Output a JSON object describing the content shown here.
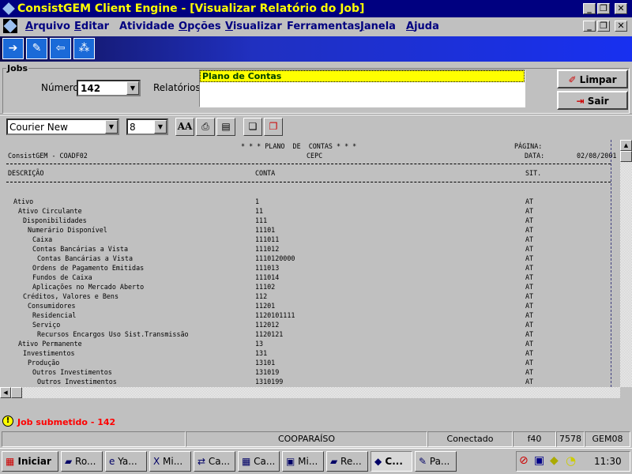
{
  "window": {
    "title": "ConsistGEM Client Engine - [Visualizar Relatório do Job]"
  },
  "menu": [
    {
      "label": "Arquivo",
      "key": "A"
    },
    {
      "label": "Editar",
      "key": "E"
    },
    {
      "label": "Atividade",
      "key": "t"
    },
    {
      "label": "Opções",
      "key": "O"
    },
    {
      "label": "Visualizar",
      "key": "V"
    },
    {
      "label": "Ferramentas",
      "key": "r"
    },
    {
      "label": "Janela",
      "key": "J"
    },
    {
      "label": "Ajuda",
      "key": "A"
    }
  ],
  "toolbar_icons": [
    "export-icon",
    "edit-document-icon",
    "import-icon",
    "network-icon"
  ],
  "jobs": {
    "group_label": "Jobs",
    "numero_label": "Número",
    "numero_value": "142",
    "relatorios_label": "Relatórios",
    "relatorios": [
      "Plano de Contas"
    ],
    "limpar_label": "Limpar",
    "sair_label": "Sair"
  },
  "format": {
    "font": "Courier New",
    "size": "8"
  },
  "report": {
    "title": "* * * PLANO  DE  CONTAS * * *",
    "subtitle": "CEPC",
    "system": "ConsistGEM - COADF02",
    "pagina_label": "PÁGINA:",
    "data_label": "DATA:",
    "data_value": "02/08/2001",
    "columns": [
      "DESCRIÇÃO",
      "CONTA",
      "SIT."
    ],
    "rows": [
      {
        "level": 0,
        "desc": "Ativo",
        "conta": "1",
        "sit": "AT"
      },
      {
        "level": 1,
        "desc": "Ativo Circulante",
        "conta": "11",
        "sit": "AT"
      },
      {
        "level": 2,
        "desc": "Disponibilidades",
        "conta": "111",
        "sit": "AT"
      },
      {
        "level": 3,
        "desc": "Numerário Disponível",
        "conta": "11101",
        "sit": "AT"
      },
      {
        "level": 4,
        "desc": "Caixa",
        "conta": "111011",
        "sit": "AT"
      },
      {
        "level": 4,
        "desc": "Contas Bancárias a Vista",
        "conta": "111012",
        "sit": "AT"
      },
      {
        "level": 5,
        "desc": "Contas Bancárias a Vista",
        "conta": "1110120000",
        "sit": "AT"
      },
      {
        "level": 4,
        "desc": "Ordens de Pagamento Emitidas",
        "conta": "111013",
        "sit": "AT"
      },
      {
        "level": 4,
        "desc": "Fundos de Caixa",
        "conta": "111014",
        "sit": "AT"
      },
      {
        "level": 4,
        "desc": "Aplicações no Mercado Aberto",
        "conta": "11102",
        "sit": "AT"
      },
      {
        "level": 2,
        "desc": "Créditos, Valores e Bens",
        "conta": "112",
        "sit": "AT"
      },
      {
        "level": 3,
        "desc": "Consumidores",
        "conta": "11201",
        "sit": "AT"
      },
      {
        "level": 4,
        "desc": "Residencial",
        "conta": "1120101111",
        "sit": "AT"
      },
      {
        "level": 4,
        "desc": "Serviço",
        "conta": "112012",
        "sit": "AT"
      },
      {
        "level": 5,
        "desc": "Recursos Encargos Uso Sist.Transmissão",
        "conta": "1120121",
        "sit": "AT"
      },
      {
        "level": 1,
        "desc": "Ativo Permanente",
        "conta": "13",
        "sit": "AT"
      },
      {
        "level": 2,
        "desc": "Investimentos",
        "conta": "131",
        "sit": "AT"
      },
      {
        "level": 3,
        "desc": "Produção",
        "conta": "13101",
        "sit": "AT"
      },
      {
        "level": 4,
        "desc": "Outros Investimentos",
        "conta": "131019",
        "sit": "AT"
      },
      {
        "level": 5,
        "desc": "Outros Investimentos",
        "conta": "1310199",
        "sit": "AT"
      }
    ]
  },
  "message": "Job submetido - 142",
  "statusbar": [
    "",
    "COOPARAÍSO",
    "Conectado",
    "f40",
    "7578",
    "GEM08"
  ],
  "taskbar": {
    "start": "Iniciar",
    "tasks": [
      "Ro...",
      "Ya...",
      "Mi...",
      "Ca...",
      "Ca...",
      "Mi...",
      "Re...",
      "C...",
      "Pa..."
    ],
    "clock": "11:30"
  },
  "colors": {
    "title_bg": "#000080",
    "title_text": "#ffff00",
    "menu_text": "#000080",
    "message": "#ff0000",
    "selection": "#ffff00"
  }
}
